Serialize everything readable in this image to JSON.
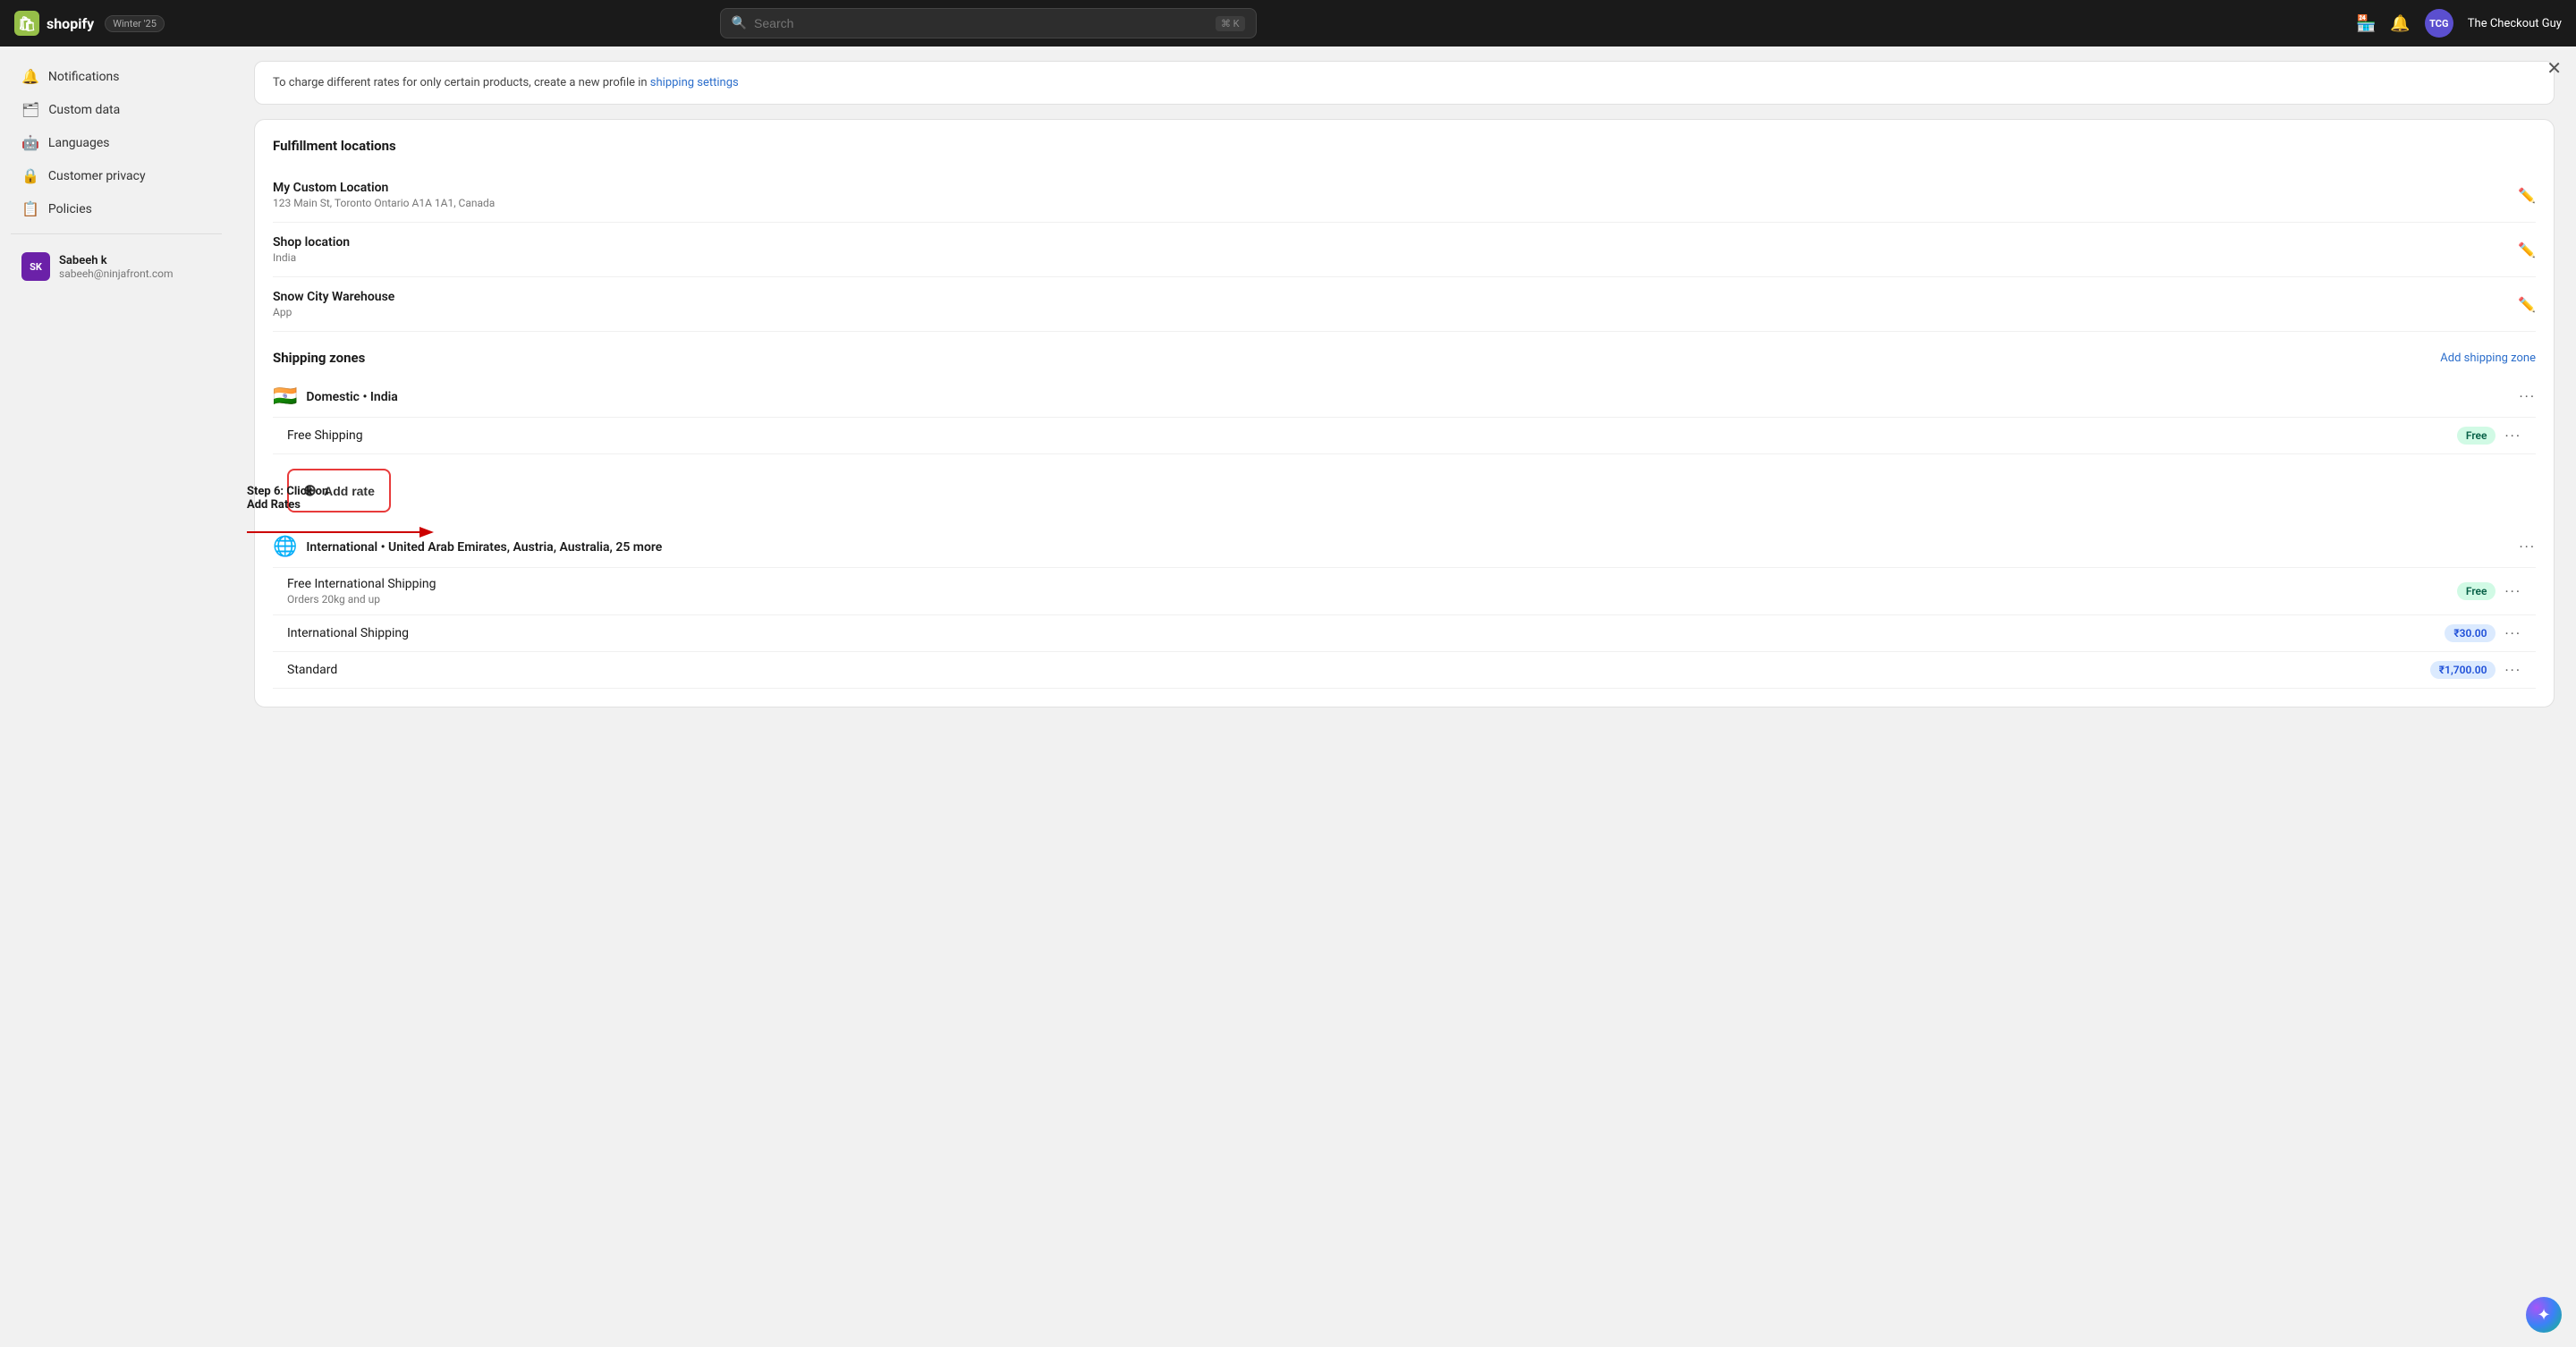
{
  "topnav": {
    "logo_text": "shopify",
    "badge": "Winter '25",
    "search_placeholder": "Search",
    "shortcut": "⌘ K",
    "user_initials": "TCG",
    "user_name": "The Checkout Guy"
  },
  "sidebar": {
    "items": [
      {
        "id": "notifications",
        "label": "Notifications",
        "icon": "🔔"
      },
      {
        "id": "custom-data",
        "label": "Custom data",
        "icon": "🗂"
      },
      {
        "id": "languages",
        "label": "Languages",
        "icon": "🤖"
      },
      {
        "id": "customer-privacy",
        "label": "Customer privacy",
        "icon": "🔒"
      },
      {
        "id": "policies",
        "label": "Policies",
        "icon": "📋"
      }
    ],
    "user": {
      "name": "Sabeeh k",
      "email": "sabeeh@ninjafront.com",
      "initials": "SK"
    }
  },
  "main": {
    "notice": {
      "text": "To charge different rates for only certain products, create a new profile in ",
      "link_text": "shipping settings",
      "link_href": "#"
    },
    "fulfillment": {
      "title": "Fulfillment locations",
      "locations": [
        {
          "name": "My Custom Location",
          "sub": "123 Main St, Toronto Ontario A1A 1A1, Canada"
        },
        {
          "name": "Shop location",
          "sub": "India"
        },
        {
          "name": "Snow City Warehouse",
          "sub": "App"
        }
      ]
    },
    "shipping_zones": {
      "title": "Shipping zones",
      "add_zone_label": "Add shipping zone",
      "zones": [
        {
          "id": "domestic",
          "flag": "🇮🇳",
          "name": "Domestic • India",
          "rates": [
            {
              "name": "Free Shipping",
              "badge_type": "free",
              "badge_text": "Free"
            },
            {
              "name": "Add rate",
              "is_add": true
            }
          ]
        },
        {
          "id": "international",
          "flag": "🌐",
          "name": "International • United Arab Emirates, Austria, Australia, 25 more",
          "rates": [
            {
              "name": "Free International Shipping",
              "sub": "Orders 20kg and up",
              "badge_type": "free",
              "badge_text": "Free"
            },
            {
              "name": "International Shipping",
              "badge_type": "price",
              "badge_text": "₹30.00"
            },
            {
              "name": "Standard",
              "badge_type": "price",
              "badge_text": "₹1,700.00"
            }
          ]
        }
      ]
    }
  },
  "step_annotation": {
    "text_line1": "Step 6: Click on",
    "text_line2": "Add Rates"
  }
}
